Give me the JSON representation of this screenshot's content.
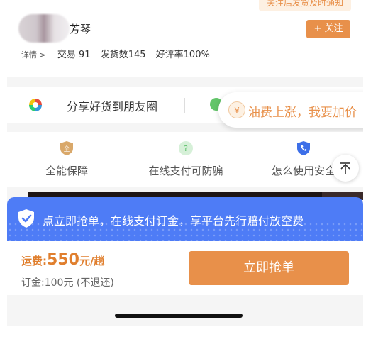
{
  "seller": {
    "name": "芳琴",
    "follow_tooltip": "关注后发货及时通知",
    "follow_label": "+ 关注",
    "detail_label": "详情 >",
    "trades": "交易 91",
    "shipments": "发货数145",
    "rating": "好评率100%"
  },
  "share": {
    "label": "分享好货到朋友圈"
  },
  "fuel": {
    "icon_text": "¥",
    "label": "油费上涨，我要加价"
  },
  "guarantees": [
    {
      "label": "全能保障",
      "icon": "shield-all-icon"
    },
    {
      "label": "在线支付可防骗",
      "icon": "question-icon"
    },
    {
      "label": "怎么使用安全",
      "icon": "phone-shield-icon"
    }
  ],
  "notice": {
    "text": "点立即抢单，在线支付订金，享平台先行赔付放空费"
  },
  "order": {
    "fee_label": "运费:",
    "fee_amount": "550",
    "fee_unit": "元/趟",
    "deposit": "订金:100元 (不退还)",
    "grab_label": "立即抢单"
  },
  "colors": {
    "accent": "#e8904a",
    "notice_blue": "#4e7cf6"
  }
}
